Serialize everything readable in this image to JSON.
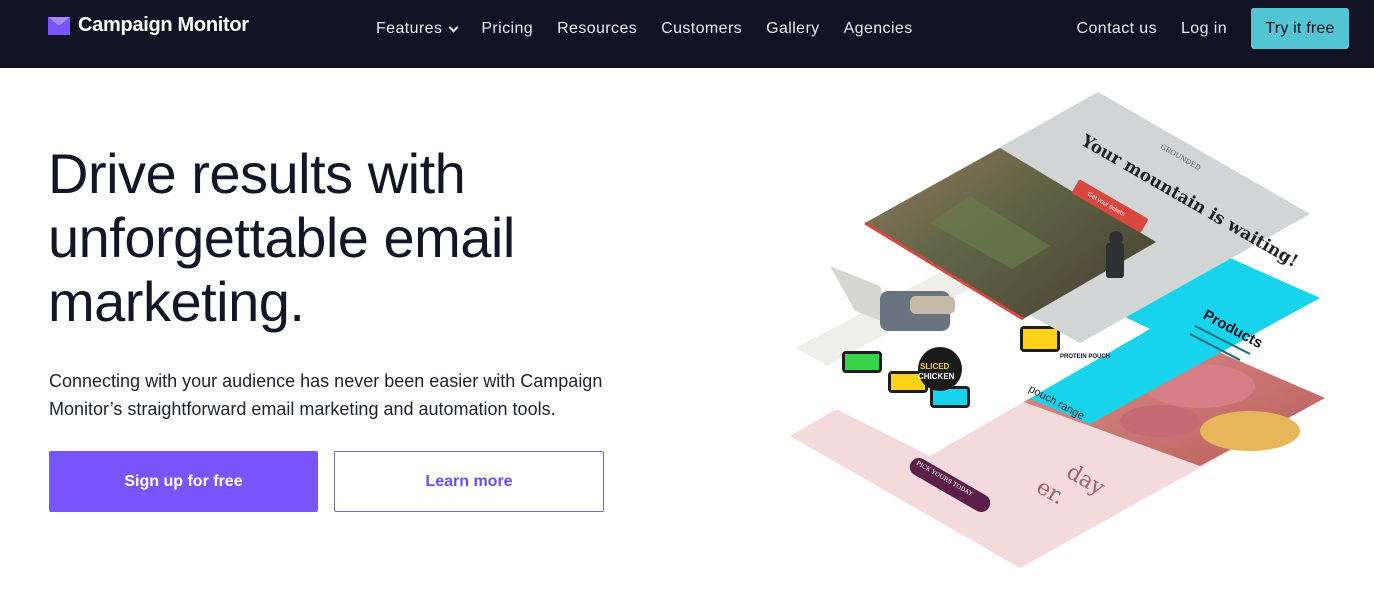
{
  "nav": {
    "brand": "Campaign Monitor",
    "links": [
      {
        "label": "Features",
        "has_dropdown": true
      },
      {
        "label": "Pricing"
      },
      {
        "label": "Resources"
      },
      {
        "label": "Customers"
      },
      {
        "label": "Gallery"
      },
      {
        "label": "Agencies"
      }
    ],
    "contact_label": "Contact us",
    "login_label": "Log in",
    "cta_label": "Try it free"
  },
  "hero": {
    "headline_line1": "Drive results with",
    "headline_line2": "unforgettable email",
    "headline_line3": "marketing.",
    "subcopy_line1": "Connecting with your audience has never been easier with Campaign",
    "subcopy_line2": "Monitor’s straightforward email marketing and automation tools.",
    "primary_cta": "Sign up for free",
    "secondary_cta": "Learn more"
  },
  "illustration": {
    "top_email_brand": "GROUNDED",
    "top_email_heading": "Your mountain is waiting!",
    "top_email_button": "Get your tickets",
    "products_heading": "Products",
    "badge_line1": "SLICED",
    "badge_line2": "CHICKEN",
    "pouch_label": "PROTEIN POUCH",
    "pouch_range": "pouch range",
    "bottom_button": "PICK YOURS TODAY",
    "bottom_script_1": "day",
    "bottom_script_2": "er."
  },
  "colors": {
    "nav_bg": "#111325",
    "accent_purple": "#7856ff",
    "accent_cyan": "#52c6d3",
    "headline": "#141627",
    "products_cyan": "#18d3ec",
    "email_red": "#d9473f"
  },
  "icons": {
    "logo": "envelope-logo-icon",
    "dropdown": "chevron-down-icon"
  }
}
